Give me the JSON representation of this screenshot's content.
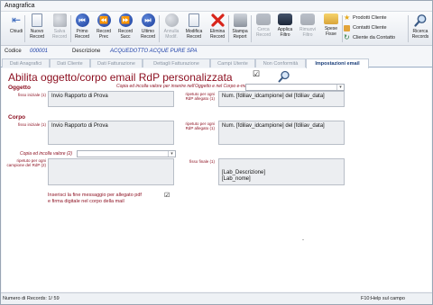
{
  "window": {
    "title": "Anagrafica"
  },
  "toolbar": {
    "buttons": [
      {
        "label": "Chiudi",
        "icon": "exit-arrow-icon",
        "enabled": true
      },
      {
        "label": "Nuovo\nRecord",
        "icon": "new-document-icon",
        "enabled": true
      },
      {
        "label": "Salva\nRecord",
        "icon": "floppy-disk-icon",
        "enabled": false
      },
      {
        "label": "Primo\nRecord",
        "icon": "first-record-icon",
        "enabled": true
      },
      {
        "label": "Record\nPrec",
        "icon": "previous-record-icon",
        "enabled": true
      },
      {
        "label": "Record\nSucc",
        "icon": "next-record-icon",
        "enabled": true
      },
      {
        "label": "Ultimo\nRecord",
        "icon": "last-record-icon",
        "enabled": true
      },
      {
        "label": "Annulla\nModif.",
        "icon": "undo-icon",
        "enabled": false
      },
      {
        "label": "Modifica\nRecord",
        "icon": "edit-document-icon",
        "enabled": true
      },
      {
        "label": "Elimina\nRecord",
        "icon": "delete-x-icon",
        "enabled": true
      },
      {
        "label": "Stampa\nReport",
        "icon": "printer-icon",
        "enabled": true
      },
      {
        "label": "Cerca\nRecord",
        "icon": "binoculars-icon",
        "enabled": false
      },
      {
        "label": "Applica\nFiltro",
        "icon": "binoculars-icon",
        "enabled": true
      },
      {
        "label": "Rimuovi\nFiltro",
        "icon": "binoculars-icon",
        "enabled": false
      },
      {
        "label": "Spese\nFisse",
        "icon": "folder-icon",
        "enabled": true
      }
    ],
    "side_items": [
      {
        "label": "Prodotti Cliente",
        "icon": "star-icon"
      },
      {
        "label": "Contatti Cliente",
        "icon": "contacts-icon"
      },
      {
        "label": "Cliente da Contatto",
        "icon": "refresh-icon"
      }
    ],
    "search": {
      "label": "Ricerca\nRecords",
      "icon": "search-icon"
    }
  },
  "record": {
    "codice_label": "Codice",
    "codice_value": "000001",
    "descrizione_label": "Descrizione",
    "descrizione_value": "ACQUEDOTTO ACQUE PURE SPA"
  },
  "tabs": [
    {
      "label": "Dati Anagrafici",
      "active": false
    },
    {
      "label": "Dati Cliente",
      "active": false
    },
    {
      "label": "Dati Fatturazione",
      "active": false
    },
    {
      "label": "Dettagli Fatturazione",
      "active": false
    },
    {
      "label": "Campi Utente",
      "active": false
    },
    {
      "label": "Non Conformità",
      "active": false
    },
    {
      "label": "Impostazioni email",
      "active": true
    }
  ],
  "settings": {
    "heading": "Abilita oggetto/corpo email RdP personalizzata",
    "heading_checked": true,
    "copy_note": "Copia ed incolla valore per inserire nell'Oggetto e nel Corpo e-mail (1)",
    "copy_combo_value": "",
    "oggetto": {
      "label": "Oggetto",
      "fixed_label": "fisso iniziale (1)",
      "fixed_value": "Invio Rapporto di Prova",
      "repeat_label": "ripetuto per ogni RdP allegato (1)",
      "repeat_value": "Num. [fdiliav_idcampione] del [fdiliav_data]"
    },
    "corpo": {
      "label": "Corpo",
      "fixed_label": "fisso iniziale (1)",
      "fixed_value": "Invio Rapporto di Prova",
      "repeat_label": "ripetuto per ogni RdP allegato (1)",
      "repeat_value": "Num. [fdiliav_idcampione] del [fdiliav_data]"
    },
    "copy2_label": "Copia ed incolla valore (2)",
    "copy2_value": "",
    "sample_label": "ripetuto per ogni campione del RdP (2)",
    "sample_value": "",
    "final_label": "fisso finale (1)",
    "final_lines": [
      "[Lab_Descrizione]",
      "[Lab_nome]"
    ],
    "end_message": "Inserisci la fine messaggio per allegato pdf\ne firma digitale nel corpo della mail",
    "end_message_checked": true,
    "dash": "-"
  },
  "status": {
    "records": "Numero di Records: 1/ 59",
    "help": "F10:Help sul campo"
  }
}
